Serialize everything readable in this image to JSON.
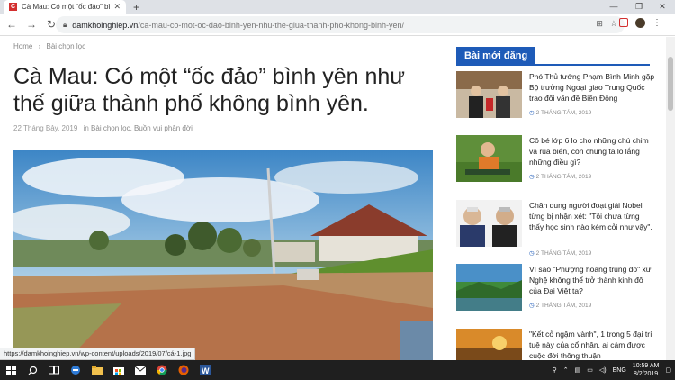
{
  "browser": {
    "tab_title": "Cà Mau: Có một “ốc đảo” bình yê",
    "tab_favicon": "C",
    "url_domain": "damkhoinghiep.vn",
    "url_path": "/ca-mau-co-mot-oc-dao-binh-yen-nhu-the-giua-thanh-pho-khong-binh-yen/",
    "status_url": "https://damkhoinghiep.vn/wp-content/uploads/2019/07/cá-1.jpg"
  },
  "article": {
    "breadcrumb": [
      "Home",
      "Bài chọn lọc"
    ],
    "title": "Cà Mau: Có một “ốc đảo” bình yên như thế giữa thành phố không bình yên.",
    "date": "22 Tháng Bảy, 2019",
    "in_label": "in",
    "categories": "Bài chọn lọc, Buồn vui phận đời"
  },
  "sidebar": {
    "heading": "Bài mới đăng",
    "posts": [
      {
        "title": "Phó Thủ tướng Phạm Bình Minh gặp Bộ trưởng Ngoại giao Trung Quốc trao đổi vấn đề Biển Đông",
        "date": "2 THÁNG TÁM, 2019"
      },
      {
        "title": "Cô bé lớp 6 lo cho những chú chim và rùa biển, còn chúng ta lo lắng những điều gì?",
        "date": "2 THÁNG TÁM, 2019"
      },
      {
        "title": "Chân dung người đoạt giải Nobel từng bị nhận xét: \"Tôi chưa từng thấy học sinh nào kém cỏi như vậy\".",
        "date": "2 THÁNG TÁM, 2019"
      },
      {
        "title": "Vì sao \"Phượng hoàng trung đô\" xứ Nghệ không thể trở thành kinh đô của Đại Việt ta?",
        "date": "2 THÁNG TÁM, 2019"
      },
      {
        "title": "\"Kết cỏ ngậm vành\", 1 trong 5 đại trí tuệ này của cổ nhân, ai cảm được cuộc đời thông thuận",
        "date": ""
      }
    ]
  },
  "taskbar": {
    "lang": "ENG",
    "time": "10:59 AM",
    "date": "8/2/2019"
  }
}
